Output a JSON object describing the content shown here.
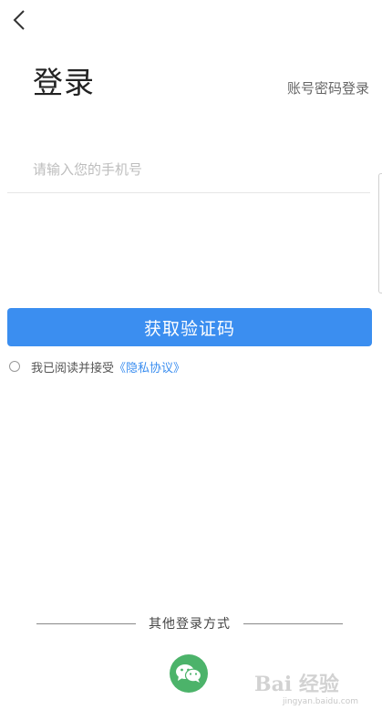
{
  "header": {
    "back_icon": "chevron-left-icon",
    "title": "登录",
    "account_login_label": "账号密码登录"
  },
  "form": {
    "phone_placeholder": "请输入您的手机号",
    "phone_value": "",
    "submit_label": "获取验证码"
  },
  "agreement": {
    "checked": false,
    "text": "我已阅读并接受",
    "link_text": "《隐私协议》"
  },
  "other_login": {
    "label": "其他登录方式",
    "methods": [
      {
        "icon": "wechat-icon"
      }
    ]
  },
  "watermark": {
    "brand": "Bai 经验",
    "url": "jingyan.baidu.com"
  },
  "colors": {
    "accent": "#3b8ef0",
    "wechat": "#4cb36a",
    "text": "#333333",
    "placeholder": "#bdbdbd"
  }
}
